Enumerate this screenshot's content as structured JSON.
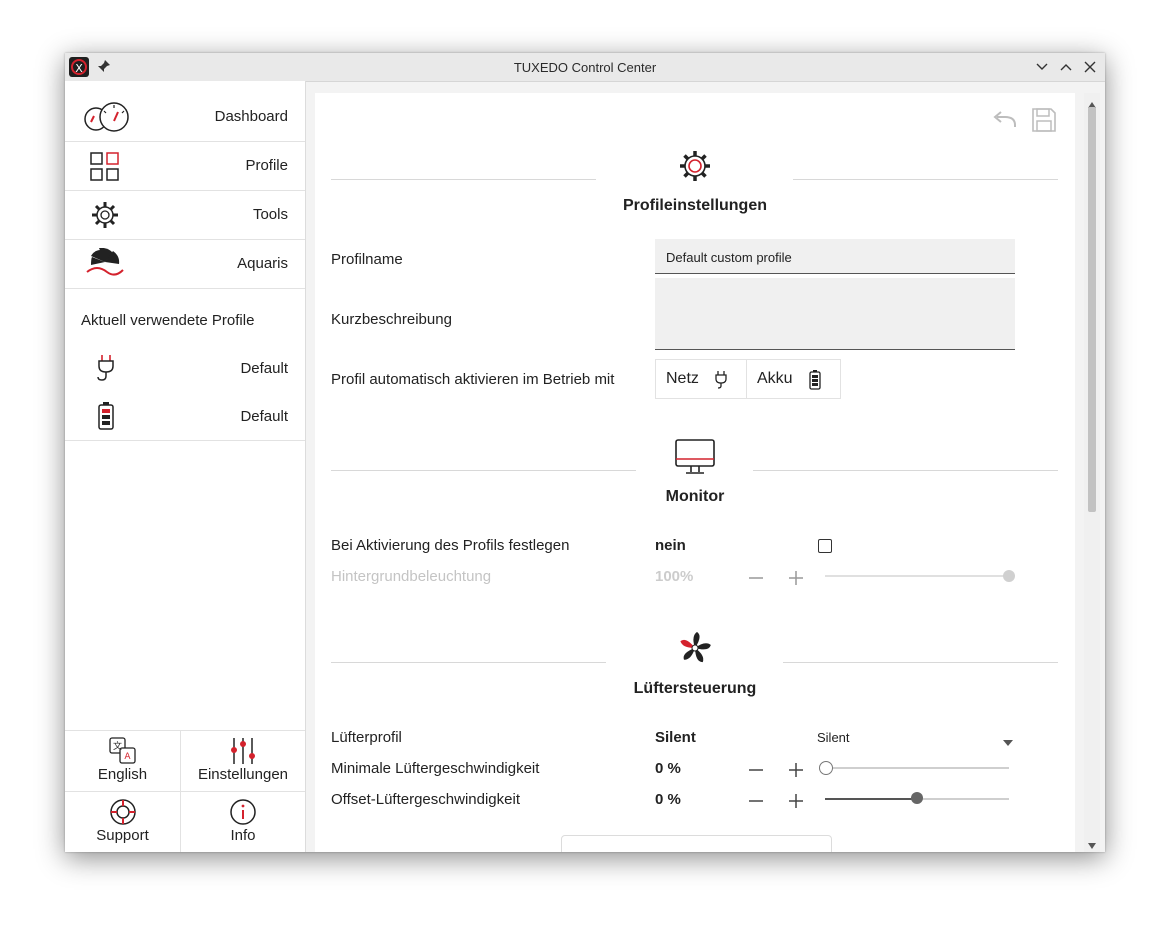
{
  "window": {
    "title": "TUXEDO Control Center"
  },
  "sidebar": {
    "nav": [
      {
        "label": "Dashboard",
        "icon": "dashboard-gauges-icon"
      },
      {
        "label": "Profile",
        "icon": "profile-grid-icon"
      },
      {
        "label": "Tools",
        "icon": "gear-icon"
      },
      {
        "label": "Aquaris",
        "icon": "aquaris-fan-icon"
      }
    ],
    "active_profiles_title": "Aktuell verwendete Profile",
    "active_profiles": [
      {
        "label": "Default",
        "icon": "power-plug-icon"
      },
      {
        "label": "Default",
        "icon": "battery-icon"
      }
    ],
    "bottom": {
      "language": "English",
      "settings": "Einstellungen",
      "support": "Support",
      "info": "Info"
    }
  },
  "profile_settings": {
    "title": "Profileinstellungen",
    "name_label": "Profilname",
    "name_value": "Default custom profile",
    "description_label": "Kurzbeschreibung",
    "description_value": "",
    "auto_activate_label": "Profil automatisch aktivieren im Betrieb mit",
    "power_options": [
      "Netz",
      "Akku"
    ]
  },
  "monitor": {
    "title": "Monitor",
    "set_on_activation_label": "Bei Aktivierung des Profils festlegen",
    "set_on_activation_value": "nein",
    "set_on_activation_checked": false,
    "backlight_label": "Hintergrundbeleuchtung",
    "backlight_value": "100%",
    "backlight_level": 1.0
  },
  "fan_control": {
    "title": "Lüftersteuerung",
    "fan_profile_label": "Lüfterprofil",
    "fan_profile_value": "Silent",
    "fan_profile_selected": "Silent",
    "min_speed_label": "Minimale Lüftergeschwindigkeit",
    "min_speed_value": "0 %",
    "min_speed_level": 0.0,
    "offset_speed_label": "Offset-Lüftergeschwindigkeit",
    "offset_speed_value": "0 %",
    "offset_speed_level": 0.5
  },
  "colors": {
    "accent": "#d4222d",
    "disabled": "#c4c4c4"
  }
}
